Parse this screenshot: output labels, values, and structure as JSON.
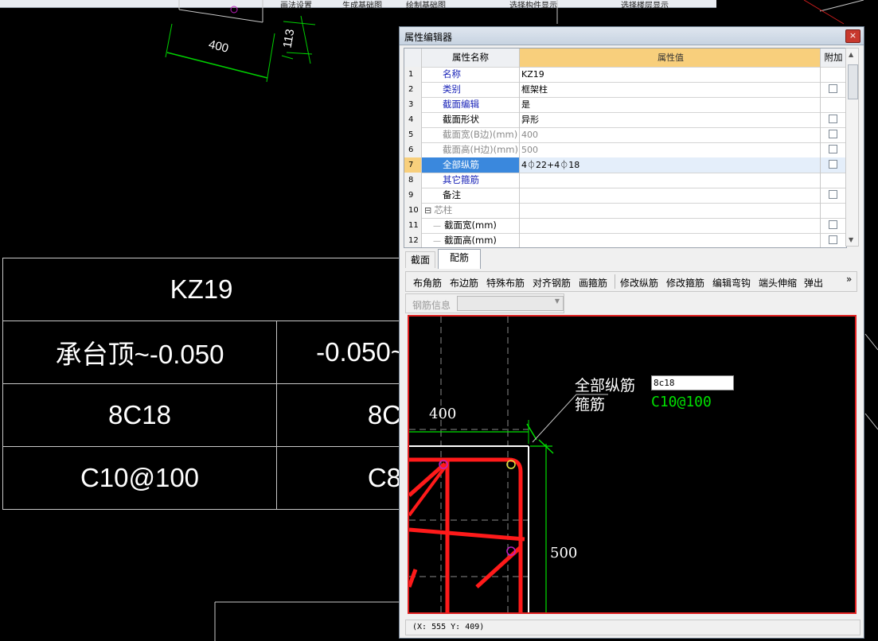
{
  "toolbar": {
    "items": [
      "画法设置",
      "生成基础图",
      "绘制基础图",
      "选择构件显示",
      "选择楼层显示"
    ]
  },
  "cad": {
    "top_dims": {
      "width": "400",
      "height": "113"
    },
    "table": {
      "name": "KZ19",
      "elevations": [
        "承台顶~-0.050",
        "-0.050~"
      ],
      "longitudinal": [
        "8C18",
        "8C"
      ],
      "stirrups": [
        "C10@100",
        "C8"
      ]
    }
  },
  "editor": {
    "title": "属性编辑器",
    "close": "×",
    "headers": {
      "name": "属性名称",
      "value": "属性值",
      "extra": "附加"
    },
    "rows": [
      {
        "n": "1",
        "name": "名称",
        "value": "KZ19",
        "style": "blue",
        "checkbox": false
      },
      {
        "n": "2",
        "name": "类别",
        "value": "框架柱",
        "style": "blue",
        "checkbox": true
      },
      {
        "n": "3",
        "name": "截面编辑",
        "value": "是",
        "style": "blue",
        "checkbox": false
      },
      {
        "n": "4",
        "name": "截面形状",
        "value": "异形",
        "style": "black",
        "checkbox": true
      },
      {
        "n": "5",
        "name": "截面宽(B边)(mm)",
        "value": "400",
        "style": "gray",
        "checkbox": true
      },
      {
        "n": "6",
        "name": "截面高(H边)(mm)",
        "value": "500",
        "style": "gray",
        "checkbox": true
      },
      {
        "n": "7",
        "name": "全部纵筋",
        "value": "4⏀22+4⏀18",
        "style": "selected",
        "checkbox": true
      },
      {
        "n": "8",
        "name": "其它箍筋",
        "value": "",
        "style": "blue",
        "checkbox": false
      },
      {
        "n": "9",
        "name": "备注",
        "value": "",
        "style": "black",
        "checkbox": true
      },
      {
        "n": "10",
        "name": "芯柱",
        "value": "",
        "style": "group",
        "checkbox": false
      },
      {
        "n": "11",
        "name": "截面宽(mm)",
        "value": "",
        "style": "child",
        "checkbox": true
      },
      {
        "n": "12",
        "name": "截面高(mm)",
        "value": "",
        "style": "child",
        "checkbox": true
      }
    ],
    "tabs": [
      "截面",
      "配筋"
    ],
    "buttons": [
      "布角筋",
      "布边筋",
      "特殊布筋",
      "对齐钢筋",
      "画箍筋",
      "修改纵筋",
      "修改箍筋",
      "编辑弯钩",
      "端头伸缩",
      "弹出"
    ],
    "more": "»",
    "rebar_info_label": "钢筋信息",
    "canvas": {
      "label_long": "全部纵筋",
      "label_stirrup": "箍筋",
      "input_value": "8c18",
      "stirrup_value": "C10@100",
      "dim_width": "400",
      "dim_height": "500"
    },
    "status": "(X: 555 Y: 409)"
  },
  "colors": {
    "accent": "#f8cf7c",
    "rebar": "#ff1a1a",
    "dim": "#00e000"
  }
}
